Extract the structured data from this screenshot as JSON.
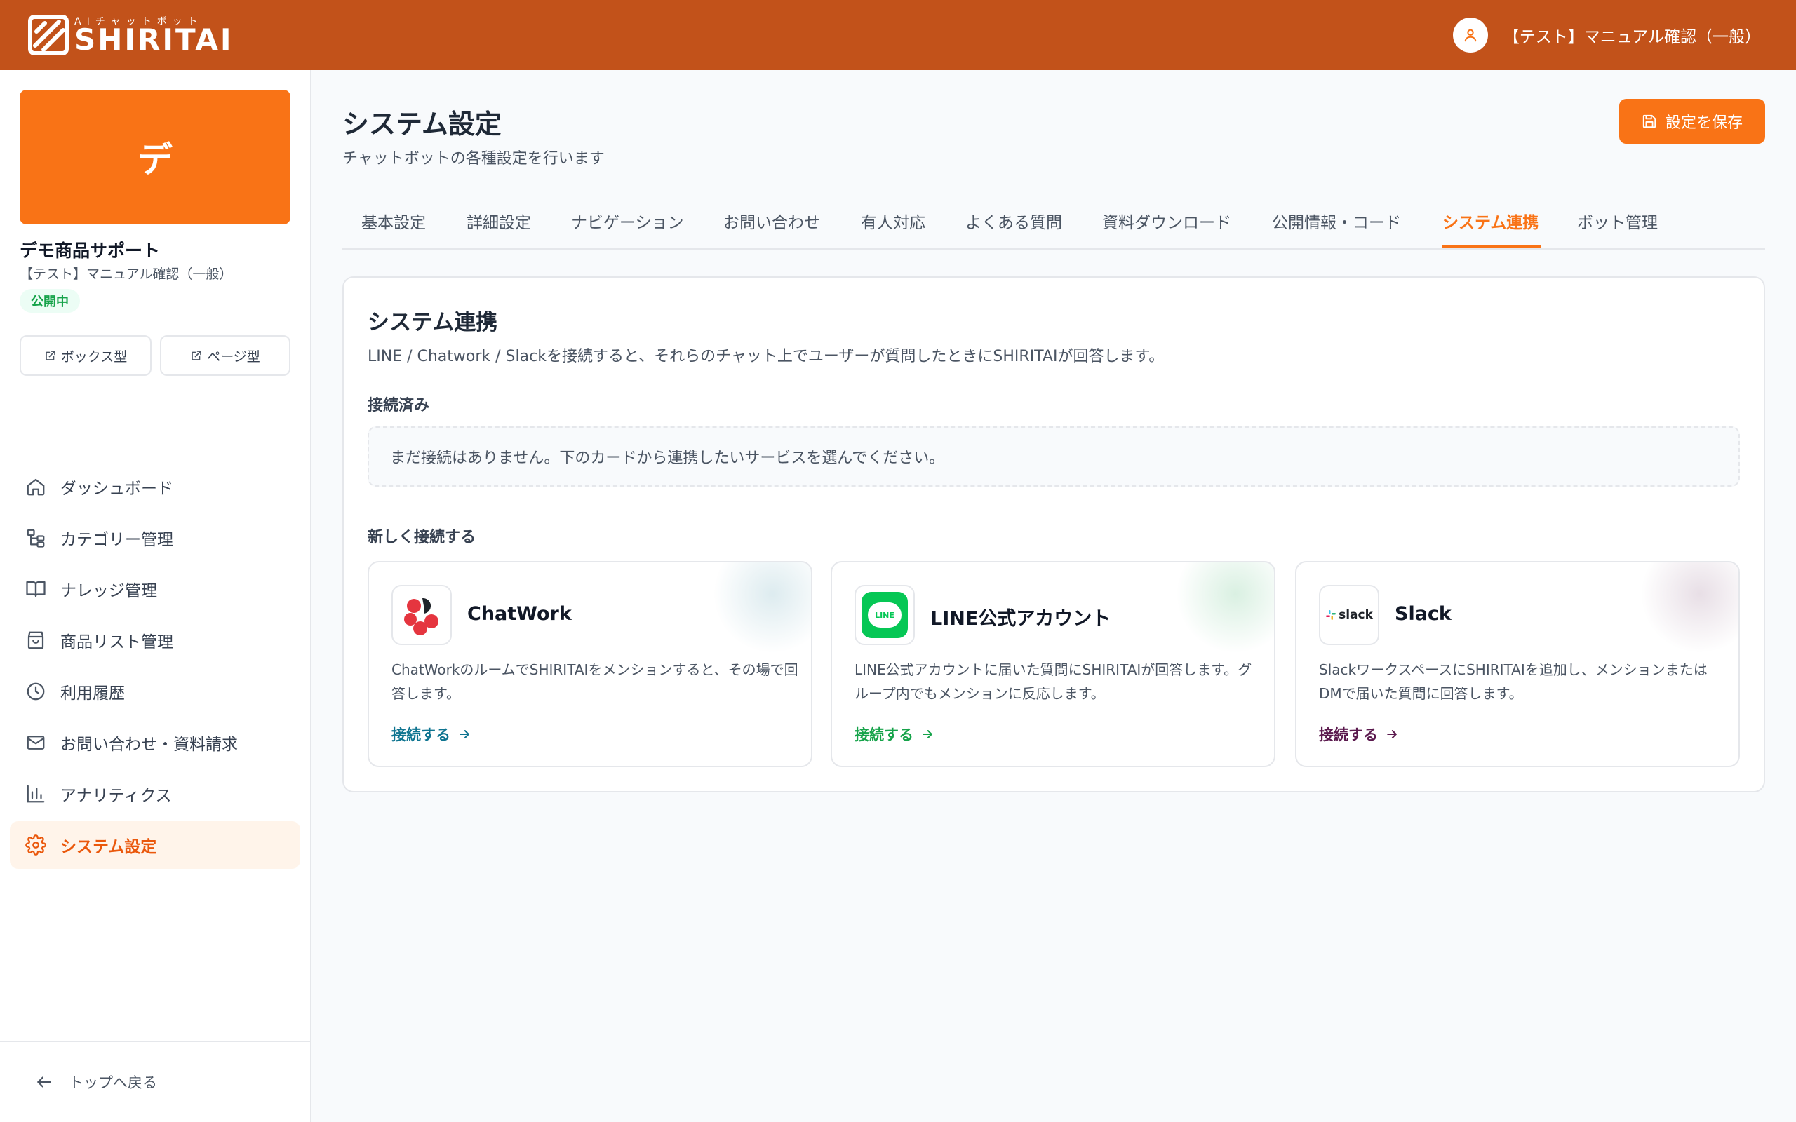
{
  "header": {
    "logo_sub": "AIチャットボット",
    "logo_main": "SHIRITAI",
    "user_name": "【テスト】マニュアル確認（一般）"
  },
  "sidebar": {
    "bot_initial": "デ",
    "bot_name": "デモ商品サポート",
    "bot_sub": "【テスト】マニュアル確認（一般）",
    "status": "公開中",
    "box_button": "ボックス型",
    "page_button": "ページ型",
    "items": [
      {
        "label": "ダッシュボード",
        "icon": "home-icon"
      },
      {
        "label": "カテゴリー管理",
        "icon": "category-tree-icon"
      },
      {
        "label": "ナレッジ管理",
        "icon": "book-icon"
      },
      {
        "label": "商品リスト管理",
        "icon": "shopping-bag-icon"
      },
      {
        "label": "利用履歴",
        "icon": "clock-icon"
      },
      {
        "label": "お問い合わせ・資料請求",
        "icon": "mail-icon"
      },
      {
        "label": "アナリティクス",
        "icon": "bar-chart-icon"
      },
      {
        "label": "システム設定",
        "icon": "gear-icon"
      }
    ],
    "active_item": "システム設定",
    "back_label": "トップへ戻る"
  },
  "page": {
    "title": "システム設定",
    "subtitle": "チャットボットの各種設定を行います",
    "save_label": "設定を保存"
  },
  "tabs": [
    "基本設定",
    "詳細設定",
    "ナビゲーション",
    "お問い合わせ",
    "有人対応",
    "よくある質問",
    "資料ダウンロード",
    "公開情報・コード",
    "システム連携",
    "ボット管理"
  ],
  "active_tab": "システム連携",
  "panel": {
    "title": "システム連携",
    "description": "LINE / Chatwork / Slackを接続すると、それらのチャット上でユーザーが質問したときにSHIRITAIが回答します。",
    "connected_label": "接続済み",
    "empty_message": "まだ接続はありません。下のカードから連携したいサービスを選んでください。",
    "new_label": "新しく接続する"
  },
  "services": [
    {
      "name": "ChatWork",
      "description": "ChatWorkのルームでSHIRITAIをメンションすると、その場で回答します。",
      "link": "接続する",
      "accent": "#0e7490",
      "icon": "chatwork-logo-icon"
    },
    {
      "name": "LINE公式アカウント",
      "description": "LINE公式アカウントに届いた質問にSHIRITAIが回答します。グループ内でもメンションに反応します。",
      "link": "接続する",
      "accent": "#16a34a",
      "icon": "line-logo-icon",
      "logo_text": "LINE"
    },
    {
      "name": "Slack",
      "description": "SlackワークスペースにSHIRITAIを追加し、メンションまたはDMで届いた質問に回答します。",
      "link": "接続する",
      "accent": "#5b1a4e",
      "icon": "slack-logo-icon",
      "logo_text": "slack"
    }
  ],
  "colors": {
    "header": "#c2521a",
    "accent": "#f97316",
    "status_green": "#16a34a"
  }
}
